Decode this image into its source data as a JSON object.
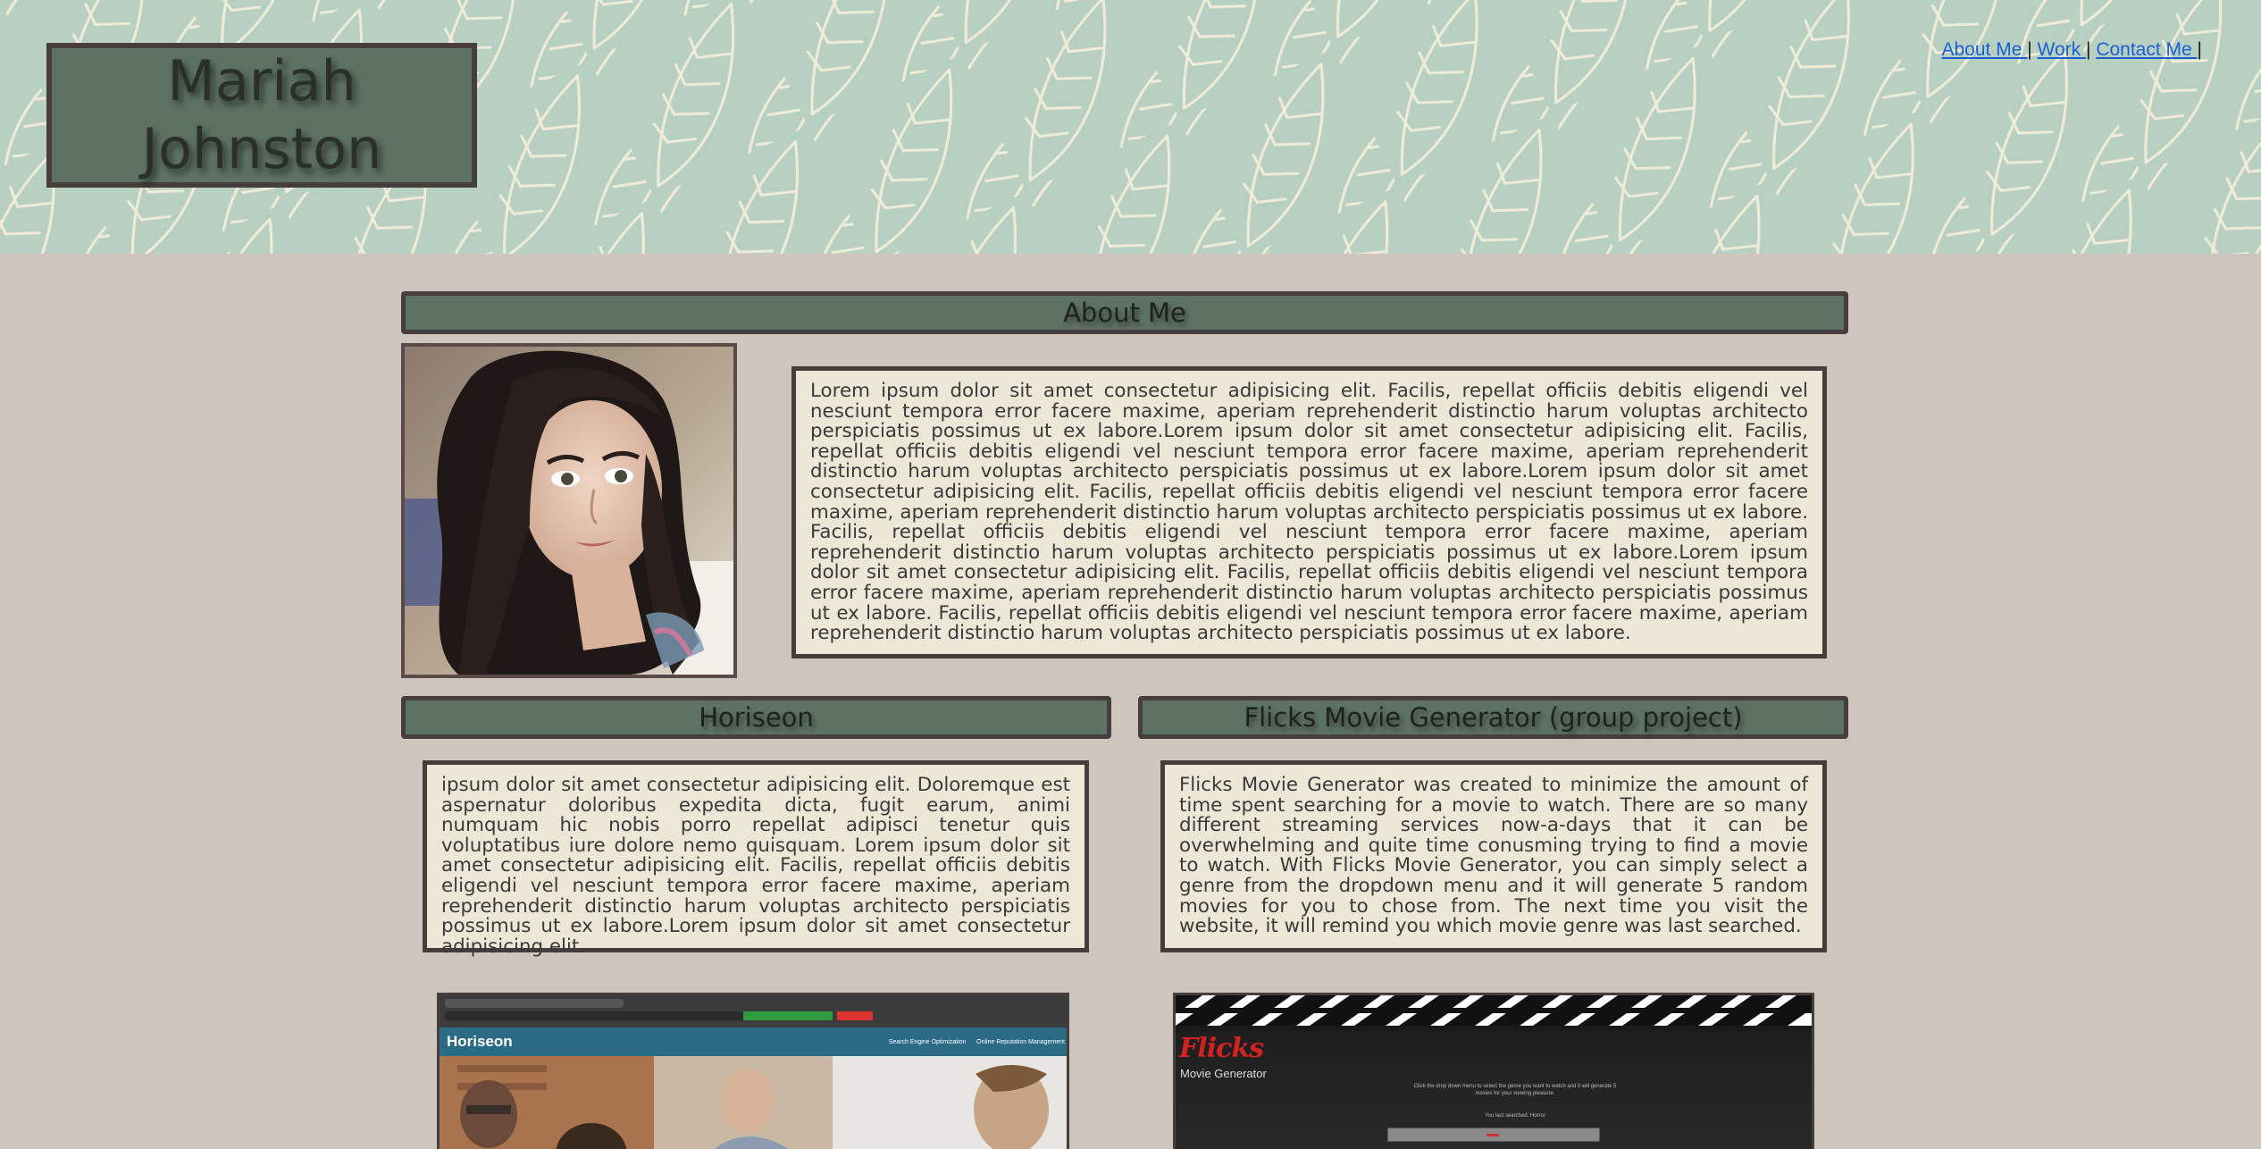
{
  "header": {
    "name_line1": "Mariah",
    "name_line2": "Johnston",
    "nav": [
      {
        "label": "About Me "
      },
      {
        "label": "Work "
      },
      {
        "label": "Contact Me "
      }
    ],
    "separator": "|"
  },
  "about": {
    "heading": "About Me",
    "body": "Lorem ipsum dolor sit amet consectetur adipisicing elit. Facilis, repellat officiis debitis eligendi vel nesciunt tempora error facere maxime, aperiam reprehenderit distinctio harum voluptas architecto perspiciatis possimus ut ex labore.Lorem ipsum dolor sit amet consectetur adipisicing elit. Facilis, repellat officiis debitis eligendi vel nesciunt tempora error facere maxime, aperiam reprehenderit distinctio harum voluptas architecto perspiciatis possimus ut ex labore.Lorem ipsum dolor sit amet consectetur adipisicing elit. Facilis, repellat officiis debitis eligendi vel nesciunt tempora error facere maxime, aperiam reprehenderit distinctio harum voluptas architecto perspiciatis possimus ut ex labore. Facilis, repellat officiis debitis eligendi vel nesciunt tempora error facere maxime, aperiam reprehenderit distinctio harum voluptas architecto perspiciatis possimus ut ex labore.Lorem ipsum dolor sit amet consectetur adipisicing elit. Facilis, repellat officiis debitis eligendi vel nesciunt tempora error facere maxime, aperiam reprehenderit distinctio harum voluptas architecto perspiciatis possimus ut ex labore. Facilis, repellat officiis debitis eligendi vel nesciunt tempora error facere maxime, aperiam reprehenderit distinctio harum voluptas architecto perspiciatis possimus ut ex labore."
  },
  "projects": [
    {
      "heading": "Horiseon",
      "body": "ipsum dolor sit amet consectetur adipisicing elit. Doloremque est aspernatur doloribus expedita dicta, fugit earum, animi numquam hic nobis porro repellat adipisci tenetur quis voluptatibus iure dolore nemo quisquam. Lorem ipsum dolor sit amet consectetur adipisicing elit. Facilis, repellat officiis debitis eligendi vel nesciunt tempora error facere maxime, aperiam reprehenderit distinctio harum voluptas architecto perspiciatis possimus ut ex labore.Lorem ipsum dolor sit amet consectetur adipisicing elit.",
      "screenshot": {
        "site_title": "Horiseon",
        "nav1": "Search Engine Optimization",
        "nav2": "Online Reputation Management"
      }
    },
    {
      "heading": "Flicks Movie Generator (group project)",
      "body": "Flicks Movie Generator was created to minimize the amount of time spent searching for a movie to watch. There are so many different streaming services now-a-days that it can be overwhelming and quite time conusming trying to find a movie to watch. With Flicks Movie Generator, you can simply select a genre from the dropdown menu and it will generate 5 random movies for you to chose from. The next time you visit the website, it will remind you which movie genre was last searched.",
      "screenshot": {
        "logo": "Flicks",
        "subtitle": "Movie Generator",
        "instructions": "Click the drop down menu to select the genre you want to watch and it will generate 5 movies for your viewing pleasure.",
        "last_searched": "You last searched: Horror"
      }
    }
  ],
  "colors": {
    "page_bg": "#cec6bd",
    "bar_bg": "#5e7263",
    "border": "#463e3c",
    "text_box_bg": "#ede7d7",
    "header_bg": "#b8d0c2",
    "link": "#1a5fd6"
  }
}
